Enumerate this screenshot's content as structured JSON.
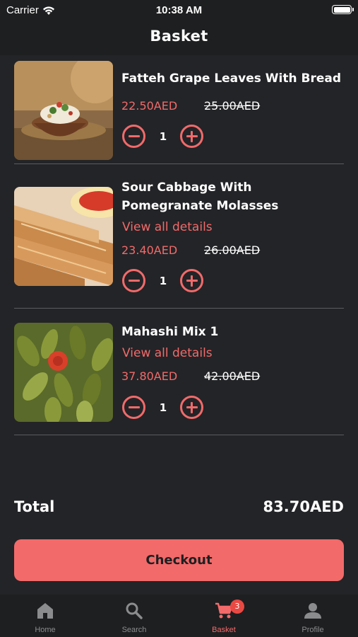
{
  "status_bar": {
    "carrier": "Carrier",
    "time": "10:38 AM",
    "battery_level": 1.0
  },
  "header": {
    "title": "Basket"
  },
  "basket_items": [
    {
      "name": "Fatteh Grape Leaves With Bread",
      "name_line2": "",
      "details_link": "",
      "price": "22.50AED",
      "old_price": "25.00AED",
      "quantity": "1"
    },
    {
      "name": "Sour Cabbage With",
      "name_line2": "Pomegranate Molasses",
      "details_link": "View all details",
      "price": "23.40AED",
      "old_price": "26.00AED",
      "quantity": "1"
    },
    {
      "name": "Mahashi Mix 1",
      "name_line2": "",
      "details_link": "View all details",
      "price": "37.80AED",
      "old_price": "42.00AED",
      "quantity": "1"
    }
  ],
  "summary": {
    "total_label": "Total",
    "total_value": "83.70AED"
  },
  "checkout": {
    "label": "Checkout"
  },
  "tab_bar": {
    "tabs": [
      {
        "label": "Home",
        "icon": "home-icon"
      },
      {
        "label": "Search",
        "icon": "search-icon"
      },
      {
        "label": "Basket",
        "icon": "cart-icon",
        "badge": "3",
        "active": true
      },
      {
        "label": "Profile",
        "icon": "person-icon"
      }
    ]
  },
  "colors": {
    "accent": "#f26a6a",
    "background": "#232427",
    "bar_background": "#1e1f21",
    "badge": "#e84a43"
  }
}
